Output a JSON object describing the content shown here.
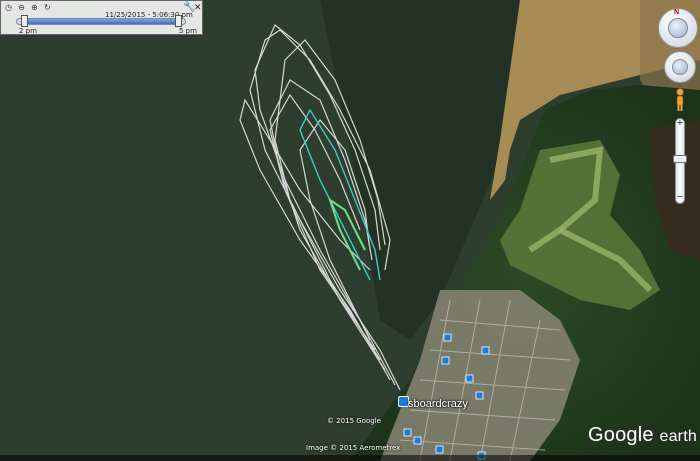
{
  "time_slider": {
    "timestamp": "11/25/2015 - 5:06:30 pm",
    "start_label": "2 pm",
    "end_label": "5 pm",
    "icons": [
      "clock-icon",
      "zoom-out-icon",
      "zoom-in-icon",
      "loop-icon"
    ]
  },
  "map": {
    "place_label": "sboardcrazy",
    "copyright_google": "© 2015 Google",
    "copyright_image": "Image © 2015 Aerometrex",
    "logo_text": "Google",
    "logo_suffix": "earth"
  },
  "colors": {
    "water": "#2d3d2e",
    "track": "#e8e8e8",
    "track_cyan": "#3fc9c4",
    "track_green": "#6fe08a",
    "marker": "#1c7cd9"
  },
  "controls": {
    "compass_label": "N",
    "zoom_in": "+",
    "zoom_out": "−"
  }
}
